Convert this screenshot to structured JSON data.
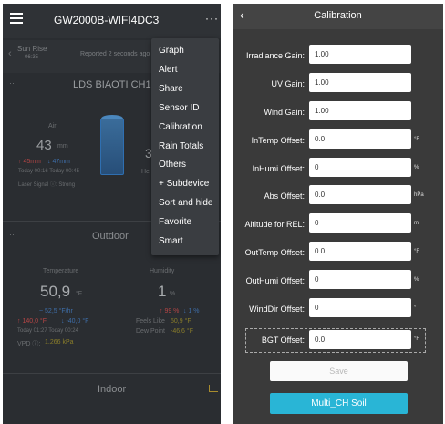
{
  "left": {
    "title": "GW2000B-WIFI4DC3",
    "more": "···",
    "sun": {
      "label": "Sun Rise",
      "time": "06:35"
    },
    "reported": "Reported 2 seconds ago",
    "sensor_title": "LDS BIAOTI CH1",
    "air_label": "Air",
    "air_value": "43",
    "air_unit": "mm",
    "air_max": "↑ 45mm",
    "air_min": "↓ 47mm",
    "air_times": "Today 00:16  Today 00:45",
    "laser_signal": "Laser Signal ⓘ: Strong",
    "side_value": "3",
    "side_label": "He",
    "outdoor_title": "Outdoor",
    "temp_label": "Temperature",
    "temp_value": "50,9",
    "temp_unit": "°F",
    "temp_change": "~ 52,5 °F/hr",
    "temp_max": "↑ 140,0 °F",
    "temp_min": "↓ -40,0 °F",
    "temp_times": "Today 01:27   Today 00:24",
    "vpd_label": "VPD ⓘ:",
    "vpd_value": "1.266 kPa",
    "humidity_label": "Humidity",
    "humidity_value": "1",
    "humidity_unit": "%",
    "hum_max": "↑ 99 %",
    "hum_min": "↓ 1 %",
    "feels_like_label": "Feels Like",
    "feels_like_value": "50,9 °F",
    "dew_point_label": "Dew Point",
    "dew_point_value": "-46,6 °F",
    "indoor_title": "Indoor",
    "menu": [
      "Graph",
      "Alert",
      "Share",
      "Sensor ID",
      "Calibration",
      "Rain Totals",
      "Others",
      "+ Subdevice",
      "Sort and hide",
      "Favorite",
      "Smart"
    ]
  },
  "right": {
    "title": "Calibration",
    "fields": [
      {
        "label": "Irradiance Gain:",
        "value": "1.00",
        "unit": ""
      },
      {
        "label": "UV Gain:",
        "value": "1.00",
        "unit": ""
      },
      {
        "label": "Wind Gain:",
        "value": "1.00",
        "unit": ""
      },
      {
        "label": "InTemp Offset:",
        "value": "0.0",
        "unit": "°F"
      },
      {
        "label": "InHumi Offset:",
        "value": "0",
        "unit": "%"
      },
      {
        "label": "Abs Offset:",
        "value": "0.0",
        "unit": "hPa"
      },
      {
        "label": "Altitude for REL:",
        "value": "0",
        "unit": "m"
      },
      {
        "label": "OutTemp Offset:",
        "value": "0.0",
        "unit": "°F"
      },
      {
        "label": "OutHumi Offset:",
        "value": "0",
        "unit": "%"
      },
      {
        "label": "WindDir Offset:",
        "value": "0",
        "unit": "°"
      },
      {
        "label": "BGT Offset:",
        "value": "0.0",
        "unit": "°F"
      }
    ],
    "save_label": "Save",
    "multi_ch_label": "Multi_CH Soil"
  }
}
